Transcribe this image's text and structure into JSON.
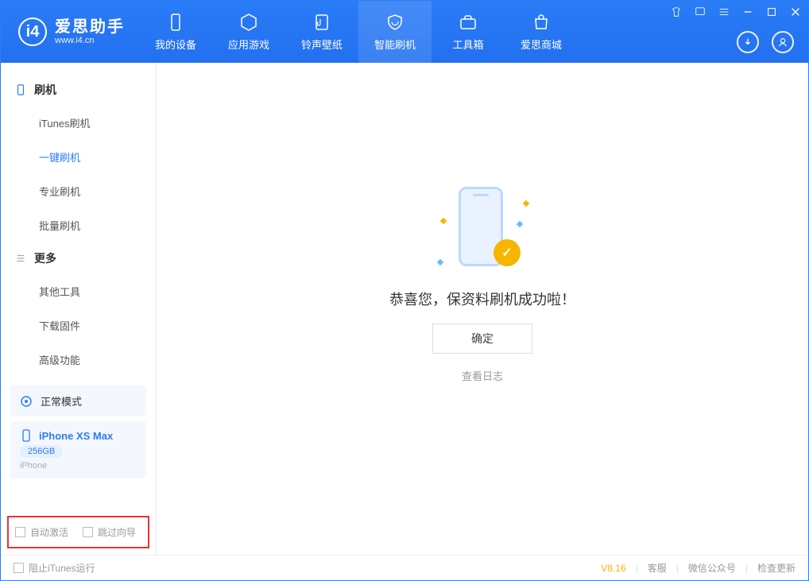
{
  "app": {
    "name": "爱思助手",
    "url": "www.i4.cn"
  },
  "nav": {
    "tabs": [
      "我的设备",
      "应用游戏",
      "铃声壁纸",
      "智能刷机",
      "工具箱",
      "爱思商城"
    ],
    "active_index": 3
  },
  "sidebar": {
    "section1": {
      "title": "刷机",
      "items": [
        "iTunes刷机",
        "一键刷机",
        "专业刷机",
        "批量刷机"
      ],
      "active_index": 1
    },
    "section2": {
      "title": "更多",
      "items": [
        "其他工具",
        "下载固件",
        "高级功能"
      ]
    }
  },
  "device": {
    "mode_label": "正常模式",
    "name": "iPhone XS Max",
    "storage": "256GB",
    "type": "iPhone"
  },
  "bottom_options": {
    "auto_activate": "自动激活",
    "skip_guide": "跳过向导"
  },
  "main": {
    "success_message": "恭喜您，保资料刷机成功啦！",
    "ok_button": "确定",
    "view_log": "查看日志"
  },
  "footer": {
    "prevent_itunes": "阻止iTunes运行",
    "version": "V8.16",
    "links": [
      "客服",
      "微信公众号",
      "检查更新"
    ]
  }
}
